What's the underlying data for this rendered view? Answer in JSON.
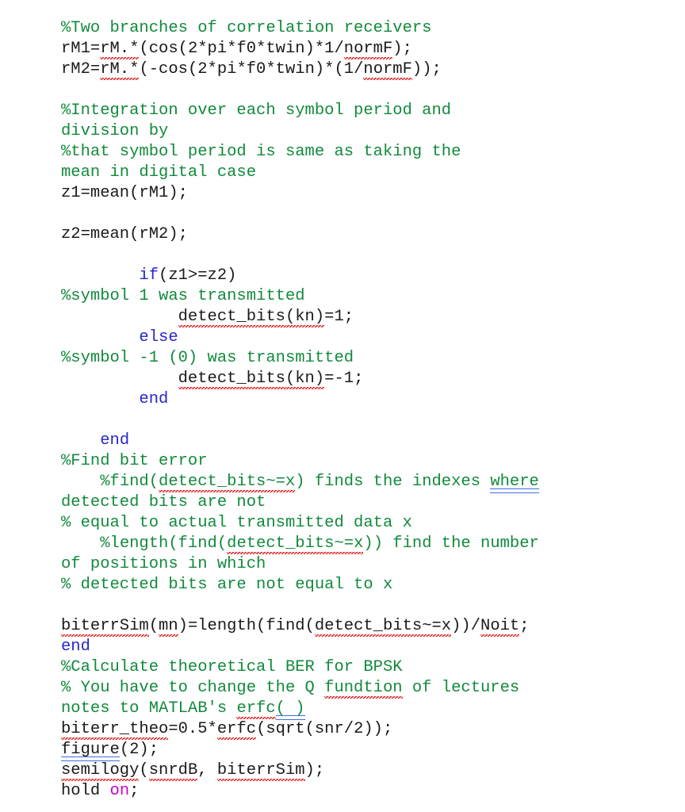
{
  "document": {
    "kind": "matlab-code-listing",
    "colors": {
      "comment_green": "#128a3c",
      "keyword_blue": "#2626cc",
      "string_magenta": "#cc00cc",
      "plain_text": "#1a1a1a",
      "spelling_underline_red": "#e02020",
      "grammar_underline_blue": "#3b6fd4",
      "page_background": "#ffffff"
    },
    "lines": [
      {
        "id": "l01",
        "indent": 8,
        "type": "comment",
        "text": "%Two branches of correlation receivers"
      },
      {
        "id": "l02",
        "indent": 8,
        "type": "code",
        "text": "rM1=rM.*(cos(2*pi*f0*twin)*1/normF);",
        "pre": "rM1=",
        "sp1": "rM.*",
        "mid": "(cos(2*pi*f0*twin)*1/",
        "sp2": "normF",
        "post": ");"
      },
      {
        "id": "l03",
        "indent": 8,
        "type": "code",
        "text": "rM2=rM.*(-cos(2*pi*f0*twin)*(1/normF));",
        "pre": "rM2=",
        "sp1": "rM.*",
        "mid": "(-cos(2*pi*f0*twin)*(1/",
        "sp2": "normF",
        "post": "));"
      },
      {
        "id": "l04",
        "indent": 0,
        "type": "blank",
        "text": ""
      },
      {
        "id": "l05",
        "indent": 8,
        "type": "comment",
        "text": "%Integration over each symbol period and"
      },
      {
        "id": "l06",
        "indent": 0,
        "type": "comment",
        "text": "division by"
      },
      {
        "id": "l07",
        "indent": 8,
        "type": "comment",
        "text": "%that symbol period is same as taking the"
      },
      {
        "id": "l08",
        "indent": 0,
        "type": "comment",
        "text": "mean in digital case"
      },
      {
        "id": "l09",
        "indent": 8,
        "type": "code",
        "text": "z1=mean(rM1);"
      },
      {
        "id": "l10",
        "indent": 0,
        "type": "blank",
        "text": ""
      },
      {
        "id": "l11",
        "indent": 8,
        "type": "code",
        "text": "z2=mean(rM2);"
      },
      {
        "id": "l12",
        "indent": 0,
        "type": "blank",
        "text": ""
      },
      {
        "id": "l13",
        "indent": 8,
        "type": "code",
        "kw": "if",
        "rest": "(z1>=z2)"
      },
      {
        "id": "l14",
        "indent": 12,
        "type": "comment",
        "text": "%symbol 1 was transmitted"
      },
      {
        "id": "l15",
        "indent": 12,
        "type": "code",
        "sp1": "detect_bits",
        "sp2": "(kn)",
        "post": "=1;"
      },
      {
        "id": "l16",
        "indent": 8,
        "type": "code",
        "kw": "else",
        "rest": ""
      },
      {
        "id": "l17",
        "indent": 12,
        "type": "comment",
        "text": "%symbol -1 (0) was transmitted"
      },
      {
        "id": "l18",
        "indent": 12,
        "type": "code",
        "sp1": "detect_bits",
        "sp2": "(kn)",
        "post": "=-1;"
      },
      {
        "id": "l19",
        "indent": 8,
        "type": "code",
        "kw": "end",
        "rest": ""
      },
      {
        "id": "l20",
        "indent": 0,
        "type": "blank",
        "text": ""
      },
      {
        "id": "l21",
        "indent": 4,
        "type": "code",
        "kw": "end",
        "rest": ""
      },
      {
        "id": "l22",
        "indent": 4,
        "type": "comment",
        "text": "%Find bit error"
      },
      {
        "id": "l23",
        "indent": 4,
        "type": "comment",
        "text": "%find(detect_bits~=x) finds the indexes where"
      },
      {
        "id": "l24",
        "indent": 0,
        "type": "comment",
        "text": "detected bits are not"
      },
      {
        "id": "l25",
        "indent": 4,
        "type": "comment",
        "text": "% equal to actual transmitted data x"
      },
      {
        "id": "l26",
        "indent": 4,
        "type": "comment",
        "text": "%length(find(detect_bits~=x)) find the number"
      },
      {
        "id": "l27",
        "indent": 0,
        "type": "comment",
        "text": "of positions in which"
      },
      {
        "id": "l28",
        "indent": 4,
        "type": "comment",
        "text": "% detected bits are not equal to x"
      },
      {
        "id": "l29",
        "indent": 0,
        "type": "blank",
        "text": ""
      },
      {
        "id": "l30",
        "indent": 0,
        "type": "code",
        "text": "biterrSim(mn)=length(find(detect_bits~=x))/Noit;"
      },
      {
        "id": "l31",
        "indent": 0,
        "type": "code",
        "kw": "end",
        "rest": ""
      },
      {
        "id": "l32",
        "indent": 0,
        "type": "comment",
        "text": "%Calculate theoretical BER for BPSK"
      },
      {
        "id": "l33",
        "indent": 0,
        "type": "comment",
        "text": "% You have to change the Q fundtion of lectures"
      },
      {
        "id": "l34",
        "indent": 0,
        "type": "comment",
        "text": "notes to MATLAB's erfc( )"
      },
      {
        "id": "l35",
        "indent": 0,
        "type": "code",
        "text": "biterr_theo=0.5*erfc(sqrt(snr/2));"
      },
      {
        "id": "l36",
        "indent": 0,
        "type": "code",
        "text": "figure(2);"
      },
      {
        "id": "l37",
        "indent": 0,
        "type": "code",
        "text": "semilogy(snrdB, biterrSim);"
      },
      {
        "id": "l38",
        "indent": 0,
        "type": "code",
        "text": "hold on;"
      }
    ],
    "tokens": {
      "kw_if": "if",
      "kw_else": "else",
      "kw_end": "end",
      "kw_on": "on",
      "l02_a": "rM1=",
      "l02_b": "rM.*",
      "l02_c": "(cos(2*pi*f0*twin)*1/",
      "l02_d": "normF",
      "l02_e": ");",
      "l03_a": "rM2=",
      "l03_b": "rM.*",
      "l03_c": "(-cos(2*pi*f0*twin)*(1/",
      "l03_d": "normF",
      "l03_e": "));",
      "l13_rest": "(z1>=z2)",
      "l15_a": "detect_bits",
      "l15_b": "(kn)",
      "l15_c": "=1;",
      "l18_a": "detect_bits",
      "l18_b": "(kn)",
      "l18_c": "=-1;",
      "l23_a": "%find(",
      "l23_b": "detect_bits~=x",
      "l23_c": ") finds the indexes ",
      "l23_d": "where",
      "l26_a": "%length(find(",
      "l26_b": "detect_bits~=x",
      "l26_c": ")) find the number",
      "l30_a": "biterrSim",
      "l30_b": "(",
      "l30_c": "mn",
      "l30_d": ")=length(find(",
      "l30_e": "detect_bits~=x",
      "l30_f": "))/",
      "l30_g": "Noit",
      "l30_h": ";",
      "l34_a": "notes to MATLAB's ",
      "l34_b": "erfc",
      "l34_c": "( )",
      "l35_a": "biterr_theo",
      "l35_b": "=0.5*",
      "l35_c": "erfc",
      "l35_d": "(sqrt(snr/2));",
      "l36_a": "figure",
      "l36_b": "(2);",
      "l37_a": "semilogy",
      "l37_b": "(",
      "l37_c": "snrdB",
      "l37_d": ", ",
      "l37_e": "biterrSim",
      "l37_f": ");",
      "l38_a": "hold ",
      "l38_b": "on",
      "l38_c": ";"
    }
  }
}
